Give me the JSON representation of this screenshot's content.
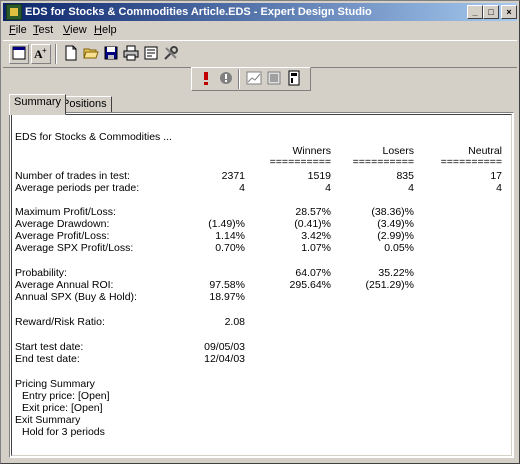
{
  "window": {
    "title": "EDS for Stocks & Commodities Article.EDS - Expert Design Studio",
    "controls": [
      "_",
      "□",
      "×"
    ]
  },
  "menu": {
    "items": [
      {
        "label": "File",
        "u": "F",
        "rest": "ile"
      },
      {
        "label": "Test",
        "u": "T",
        "rest": "est"
      },
      {
        "label": "View",
        "u": "V",
        "rest": "iew"
      },
      {
        "label": "Help",
        "u": "H",
        "rest": "elp"
      }
    ]
  },
  "toolbar": {
    "tools": [
      "window-icon",
      "font-icon",
      "new-icon",
      "open-icon",
      "save-icon",
      "print-icon",
      "properties-icon",
      "tools-icon"
    ],
    "test_tools": [
      "error-icon",
      "info-icon",
      "chart-icon",
      "report-icon",
      "settings-icon"
    ]
  },
  "tabs": [
    {
      "label": "Summary",
      "active": true
    },
    {
      "label": "Positions",
      "active": false
    }
  ],
  "report": {
    "heading": "EDS for Stocks & Commodities ...",
    "columns": [
      "Winners",
      "Losers",
      "Neutral"
    ],
    "underline": "==========",
    "rows": [
      {
        "label": "Number of trades in test:",
        "total": "2371",
        "winners": "1519",
        "losers": "835",
        "neutral": "17"
      },
      {
        "label": "Average periods per trade:",
        "total": "4",
        "winners": "4",
        "losers": "4",
        "neutral": "4"
      },
      {
        "label": "Maximum Profit/Loss:",
        "total": "",
        "winners": "28.57%",
        "losers": "(38.36)%",
        "neutral": ""
      },
      {
        "label": "Average Drawdown:",
        "total": "(1.49)%",
        "winners": "(0.41)%",
        "losers": "(3.49)%",
        "neutral": ""
      },
      {
        "label": "Average Profit/Loss:",
        "total": "1.14%",
        "winners": "3.42%",
        "losers": "(2.99)%",
        "neutral": ""
      },
      {
        "label": "Average SPX Profit/Loss:",
        "total": "0.70%",
        "winners": "1.07%",
        "losers": "0.05%",
        "neutral": ""
      },
      {
        "label": "Probability:",
        "total": "",
        "winners": "64.07%",
        "losers": "35.22%",
        "neutral": ""
      },
      {
        "label": "Average Annual ROI:",
        "total": "97.58%",
        "winners": "295.64%",
        "losers": "(251.29)%",
        "neutral": ""
      },
      {
        "label": "Annual SPX (Buy & Hold):",
        "total": "18.97%",
        "winners": "",
        "losers": "",
        "neutral": ""
      },
      {
        "label": "Reward/Risk Ratio:",
        "total": "2.08",
        "winners": "",
        "losers": "",
        "neutral": ""
      },
      {
        "label": "Start test date:",
        "total": "09/05/03",
        "winners": "",
        "losers": "",
        "neutral": ""
      },
      {
        "label": "End test date:",
        "total": "12/04/03",
        "winners": "",
        "losers": "",
        "neutral": ""
      }
    ],
    "pricing": {
      "title": "Pricing Summary",
      "entry": "Entry price: [Open]",
      "exit": "Exit price: [Open]"
    },
    "exit_summary": {
      "title": "Exit Summary",
      "hold": "Hold for 3 periods"
    }
  }
}
